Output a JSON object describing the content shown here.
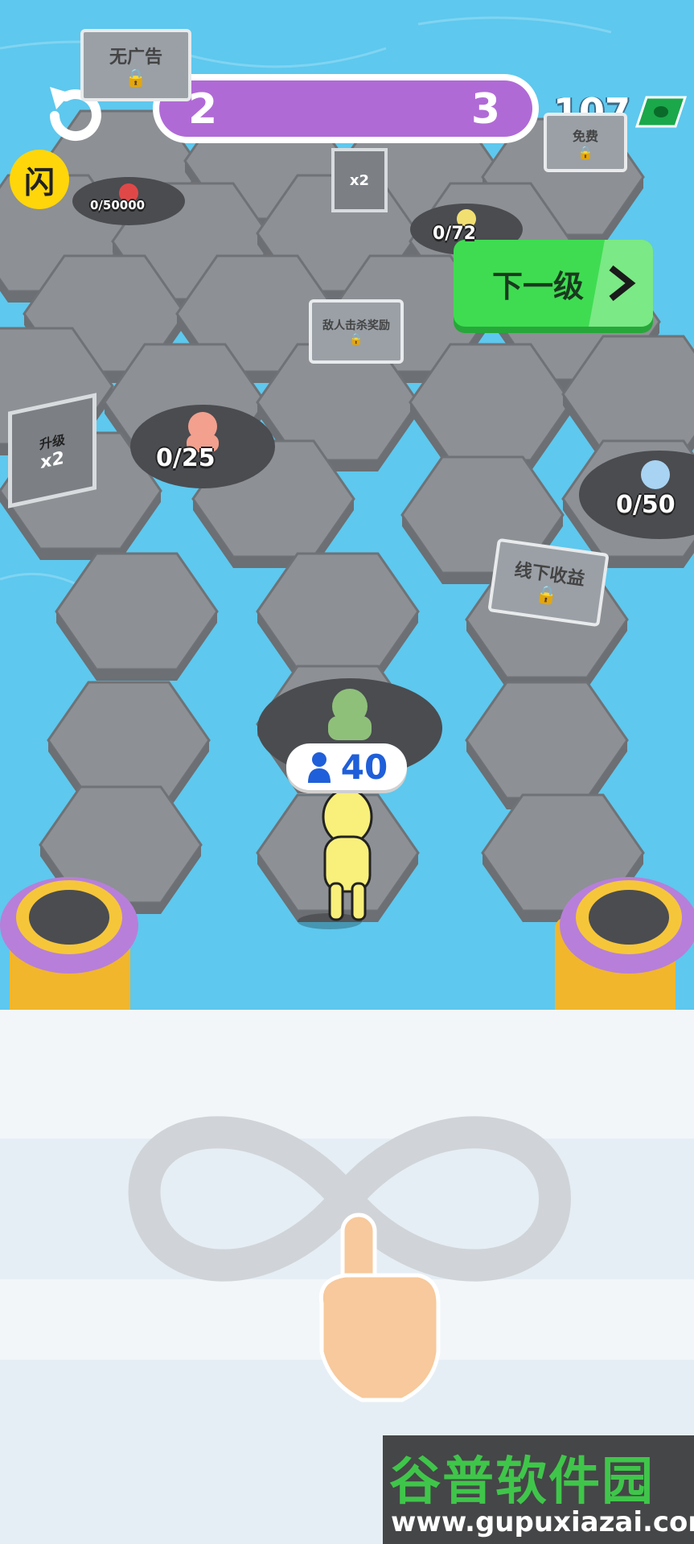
{
  "hud": {
    "level_current": "2",
    "level_next": "3",
    "money": "107",
    "flash_label": "闪",
    "next_level_label": "下一级"
  },
  "signs": {
    "no_ads": "无广告",
    "free": "免费",
    "enemy_kill_reward": "敌人击杀奖励",
    "offline_earnings": "线下收益",
    "x2": "x2",
    "upgrade": "升级"
  },
  "pads": {
    "top_red": "0/50000",
    "top_yellow": "0/72",
    "mid_pink": "0/25",
    "right_blue": "0/50"
  },
  "player": {
    "crowd_count": "40"
  },
  "watermark": {
    "title": "谷普软件园",
    "url": "www.gupuxiazai.com"
  },
  "colors": {
    "water": "#5ec8ee",
    "tile": "#8a8d91",
    "progress": "#b06ad6",
    "next_button": "#3fdc52",
    "player": "#f8f07a"
  }
}
